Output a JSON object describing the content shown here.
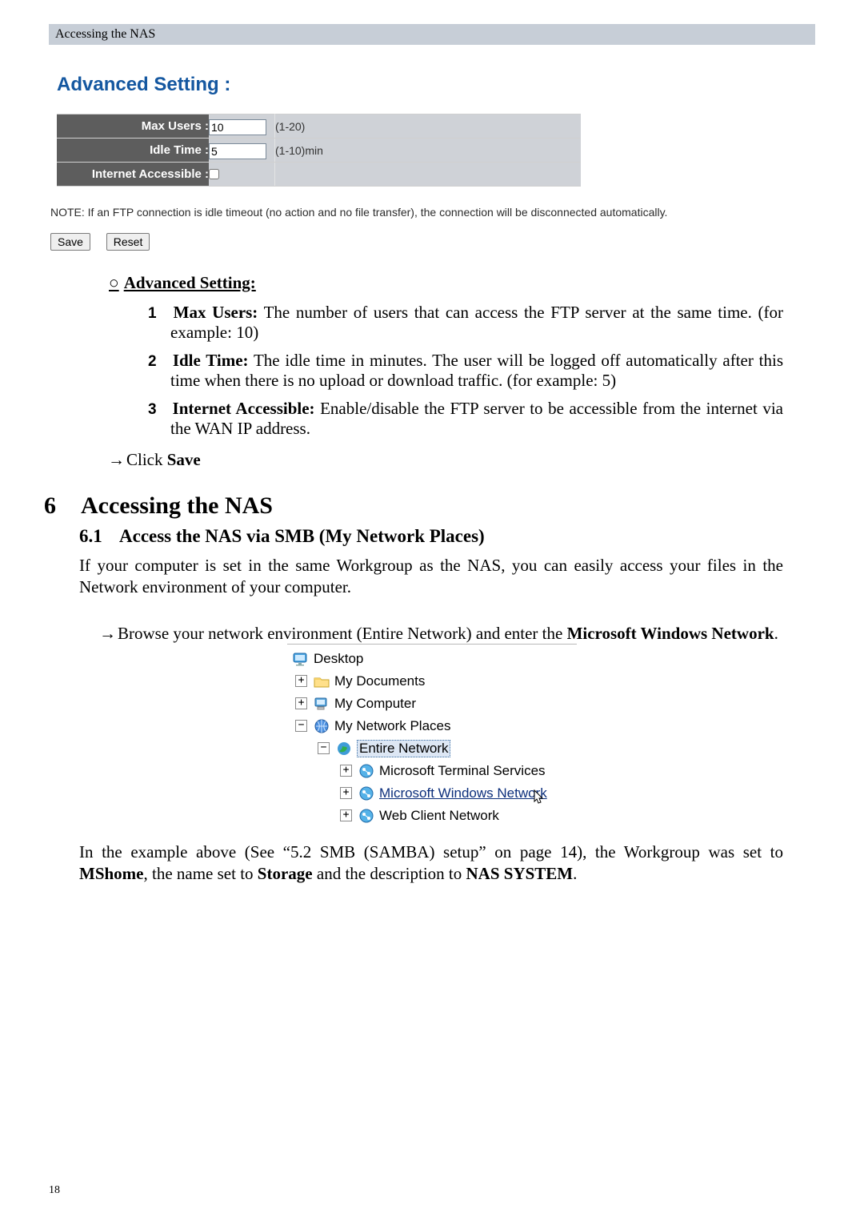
{
  "header": {
    "breadcrumb": "Accessing the NAS"
  },
  "ui": {
    "title": "Advanced Setting  :",
    "rows": {
      "max_users": {
        "label": "Max Users :",
        "value": "10",
        "hint": "(1-20)"
      },
      "idle_time": {
        "label": "Idle Time :",
        "value": "5",
        "hint": "(1-10)min"
      },
      "internet": {
        "label": "Internet Accessible :",
        "hint": ""
      }
    },
    "note": "NOTE: If an FTP connection is idle timeout (no action and no file transfer), the connection will be disconnected automatically.",
    "buttons": {
      "save": "Save",
      "reset": "Reset"
    }
  },
  "advanced": {
    "heading": "Advanced Setting:",
    "items": {
      "1": {
        "term": "Max Users:",
        "body": " The number of users that can access the FTP server at the same time. (for example: 10)"
      },
      "2": {
        "term": "Idle Time:",
        "body": " The idle time in minutes. The user will be logged off automatically after this time when there is no upload or download traffic. (for example: 5)"
      },
      "3": {
        "term": "Internet Accessible:",
        "body": " Enable/disable the FTP server to be accessible from the internet via the WAN IP address."
      }
    }
  },
  "click_save": {
    "prefix": "Click ",
    "bold": "Save"
  },
  "sec6": {
    "num": "6",
    "title": "Accessing the NAS"
  },
  "sec61": {
    "num": "6.1",
    "title": "Access the NAS via SMB (My Network Places)"
  },
  "intro61": "If your computer is set in the same Workgroup as the NAS, you can easily access your files in the Network environment of your computer.",
  "browse": {
    "pre": "Browse your network environment (Entire Network) and enter the ",
    "bold1": "Microsoft Windows Network",
    "post": "."
  },
  "tree": {
    "desktop": "Desktop",
    "my_documents": "My Documents",
    "my_computer": "My Computer",
    "my_network_places": "My Network Places",
    "entire_network": "Entire Network",
    "ms_terminal": "Microsoft Terminal Services",
    "ms_windows_net": "Microsoft Windows Network",
    "web_client_net": "Web Client Network"
  },
  "example": {
    "t": "In the example above (See “5.2 SMB (SAMBA) setup” on page 14), the Workgroup was set to ",
    "b1": "MShome",
    "m1": ", the name set to ",
    "b2": "Storage",
    "m2": " and the description to ",
    "b3": "NAS SYSTEM",
    "end": "."
  },
  "page_number": "18"
}
